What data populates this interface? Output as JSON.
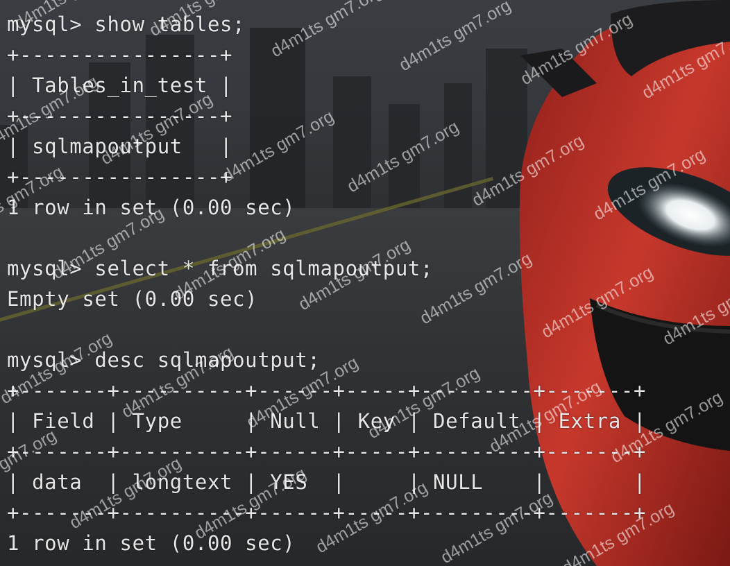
{
  "terminal": {
    "lines": [
      "mysql> show tables;",
      "+----------------+",
      "| Tables_in_test |",
      "+----------------+",
      "| sqlmapoutput   |",
      "+----------------+",
      "1 row in set (0.00 sec)",
      "",
      "mysql> select * from sqlmapoutput;",
      "Empty set (0.00 sec)",
      "",
      "mysql> desc sqlmapoutput;",
      "+-------+----------+------+-----+---------+-------+",
      "| Field | Type     | Null | Key | Default | Extra |",
      "+-------+----------+------+-----+---------+-------+",
      "| data  | longtext | YES  |     | NULL    |       |",
      "+-------+----------+------+-----+---------+-------+",
      "1 row in set (0.00 sec)"
    ]
  },
  "watermark": {
    "text": "d4m1ts gm7.org"
  },
  "colors": {
    "text": "#e6e6e6",
    "car_red": "#c0392b",
    "background": "#2b2d30"
  }
}
